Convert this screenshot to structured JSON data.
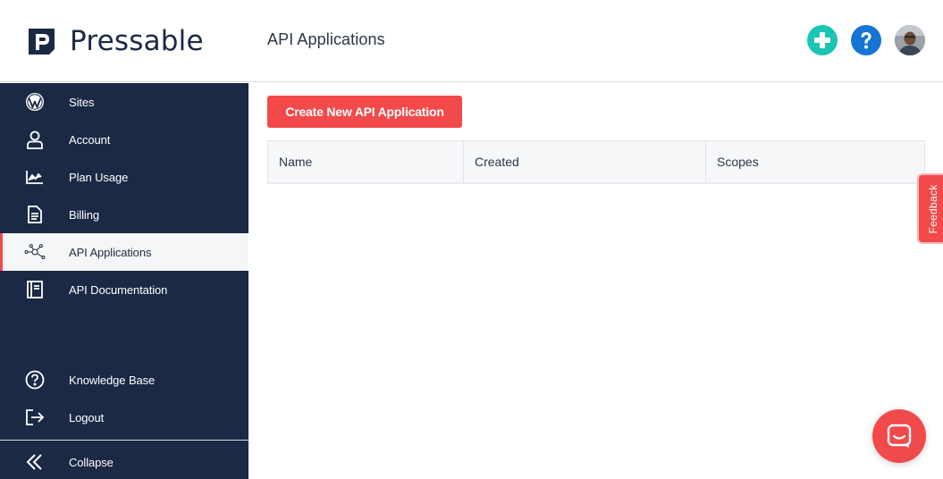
{
  "brand": {
    "name": "Pressable",
    "mark_letter": "P"
  },
  "header": {
    "page_title": "API Applications",
    "actions": [
      {
        "name": "add-icon",
        "color": "#1bc5b4"
      },
      {
        "name": "help-icon",
        "color": "#1574d4"
      }
    ]
  },
  "sidebar": {
    "items": [
      {
        "label": "Sites",
        "icon": "wordpress-icon"
      },
      {
        "label": "Account",
        "icon": "user-icon"
      },
      {
        "label": "Plan Usage",
        "icon": "chart-icon"
      },
      {
        "label": "Billing",
        "icon": "document-icon"
      },
      {
        "label": "API Applications",
        "icon": "api-nodes-icon",
        "active": true
      },
      {
        "label": "API Documentation",
        "icon": "book-icon"
      }
    ],
    "bottom_items": [
      {
        "label": "Knowledge Base",
        "icon": "question-circle-icon"
      },
      {
        "label": "Logout",
        "icon": "logout-icon"
      }
    ],
    "collapse": {
      "label": "Collapse",
      "icon": "double-chevron-left-icon"
    }
  },
  "main": {
    "create_button": "Create New API Application",
    "table": {
      "columns": [
        "Name",
        "Created",
        "Scopes"
      ],
      "rows": []
    }
  },
  "feedback": {
    "label": "Feedback"
  },
  "colors": {
    "accent": "#f2494b",
    "sidebar": "#1b2945",
    "teal": "#1bc5b4",
    "blue": "#1574d4"
  }
}
